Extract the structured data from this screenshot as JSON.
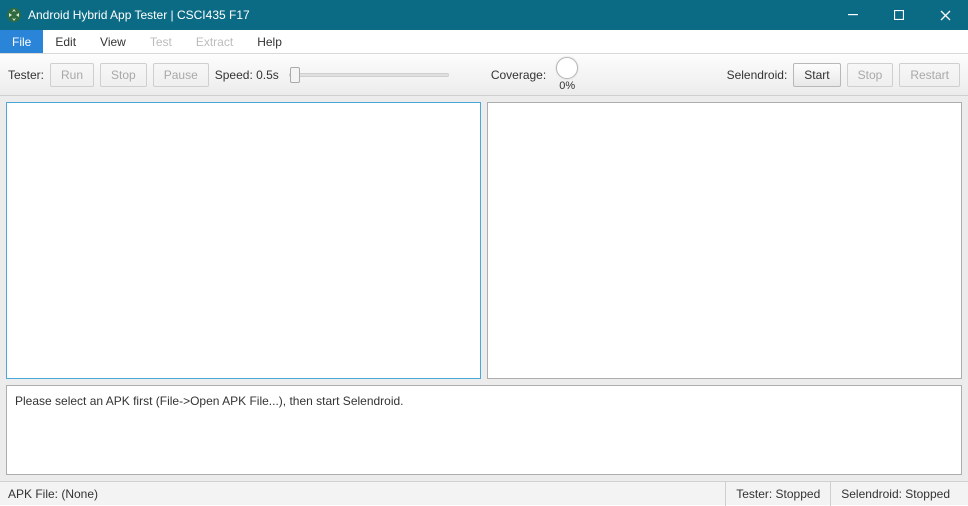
{
  "window": {
    "title": "Android Hybrid App Tester | CSCI435 F17"
  },
  "menu": {
    "file": "File",
    "edit": "Edit",
    "view": "View",
    "test": "Test",
    "extract": "Extract",
    "help": "Help"
  },
  "toolbar": {
    "tester_label": "Tester:",
    "run": "Run",
    "stop": "Stop",
    "pause": "Pause",
    "speed_label": "Speed: 0.5s",
    "coverage_label": "Coverage:",
    "coverage_value": "0%",
    "selendroid_label": "Selendroid:",
    "start": "Start",
    "sel_stop": "Stop",
    "restart": "Restart"
  },
  "message": "Please select an APK first (File->Open APK File...), then start Selendroid.",
  "status": {
    "apk": "APK File: (None)",
    "tester": "Tester: Stopped",
    "selendroid": "Selendroid: Stopped"
  }
}
